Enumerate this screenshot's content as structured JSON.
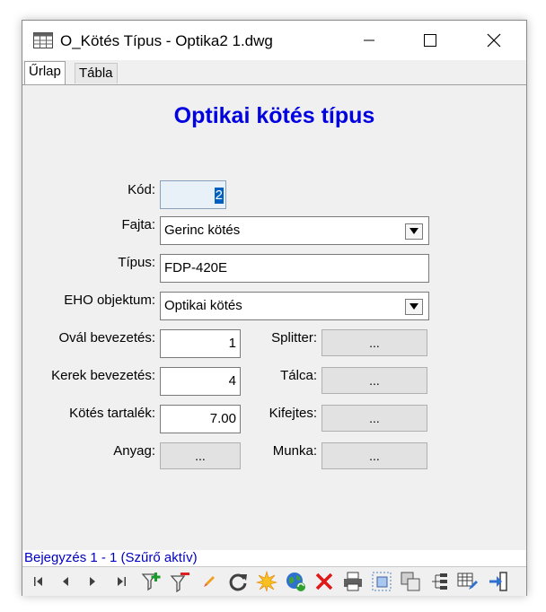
{
  "window": {
    "title": "O_Kötés Típus - Optika2 1.dwg"
  },
  "tabs": [
    {
      "label": "Űrlap"
    },
    {
      "label": "Tábla"
    }
  ],
  "form": {
    "heading": "Optikai kötés típus",
    "kod": {
      "label": "Kód:",
      "value": "2"
    },
    "fajta": {
      "label": "Fajta:",
      "value": "Gerinc kötés"
    },
    "tipus": {
      "label": "Típus:",
      "value": "FDP-420E"
    },
    "eho": {
      "label": "EHO objektum:",
      "value": "Optikai kötés"
    },
    "oval": {
      "label": "Ovál bevezetés:",
      "value": "1"
    },
    "kerek": {
      "label": "Kerek bevezetés:",
      "value": "4"
    },
    "tartalek": {
      "label": "Kötés tartalék:",
      "value": "7.00"
    },
    "anyag": {
      "label": "Anyag:",
      "button": "..."
    },
    "splitter": {
      "label": "Splitter:",
      "button": "..."
    },
    "talca": {
      "label": "Tálca:",
      "button": "..."
    },
    "kifejtes": {
      "label": "Kifejtes:",
      "button": "..."
    },
    "munka": {
      "label": "Munka:",
      "button": "..."
    }
  },
  "status": {
    "text": "Bejegyzés 1 - 1 (Szűrő aktív)"
  },
  "colors": {
    "heading": "#0000e0",
    "status": "#0000c0",
    "selection": "#0060c0"
  },
  "toolbar": {
    "icons": [
      "first-record-icon",
      "prev-record-icon",
      "next-record-icon",
      "last-record-icon",
      "add-filter-icon",
      "remove-filter-icon",
      "edit-icon",
      "refresh-icon",
      "new-record-icon",
      "globe-icon",
      "delete-icon",
      "print-icon",
      "select-icon",
      "copy-icon",
      "tree-icon",
      "table-edit-icon",
      "exit-icon"
    ]
  }
}
